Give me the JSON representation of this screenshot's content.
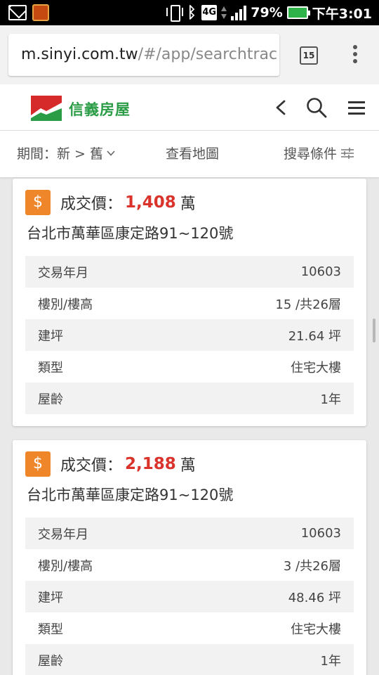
{
  "status_bar": {
    "battery": "79%",
    "time": "下午3:01",
    "network": "4G",
    "icons": [
      "mail-icon",
      "app-icon",
      "vibrate-icon",
      "bluetooth-icon",
      "network-4g-icon",
      "data-arrows-icon",
      "signal-icon",
      "battery-charging-icon"
    ]
  },
  "browser": {
    "url_host": "m.sinyi.com.tw",
    "url_path": "/#/app/searchtrac",
    "tab_count": "15"
  },
  "header": {
    "brand": "信義房屋"
  },
  "filters": {
    "period": "期間：新 > 舊",
    "map": "查看地圖",
    "search": "搜尋條件"
  },
  "listings": [
    {
      "price_label": "成交價：",
      "price": "1,408",
      "unit": "萬",
      "address": "台北市萬華區康定路91~120號",
      "details": [
        {
          "label": "交易年月",
          "value": "10603"
        },
        {
          "label": "樓別/樓高",
          "value": "15 /共26層"
        },
        {
          "label": "建坪",
          "value": "21.64 坪"
        },
        {
          "label": "類型",
          "value": "住宅大樓"
        },
        {
          "label": "屋齡",
          "value": "1年"
        }
      ]
    },
    {
      "price_label": "成交價：",
      "price": "2,188",
      "unit": "萬",
      "address": "台北市萬華區康定路91~120號",
      "details": [
        {
          "label": "交易年月",
          "value": "10603"
        },
        {
          "label": "樓別/樓高",
          "value": "3 /共26層"
        },
        {
          "label": "建坪",
          "value": "48.46 坪"
        },
        {
          "label": "類型",
          "value": "住宅大樓"
        },
        {
          "label": "屋齡",
          "value": "1年"
        }
      ]
    }
  ],
  "colors": {
    "brand_green": "#2a9c46",
    "price_red": "#d9332b",
    "dollar_orange": "#f0862a"
  }
}
